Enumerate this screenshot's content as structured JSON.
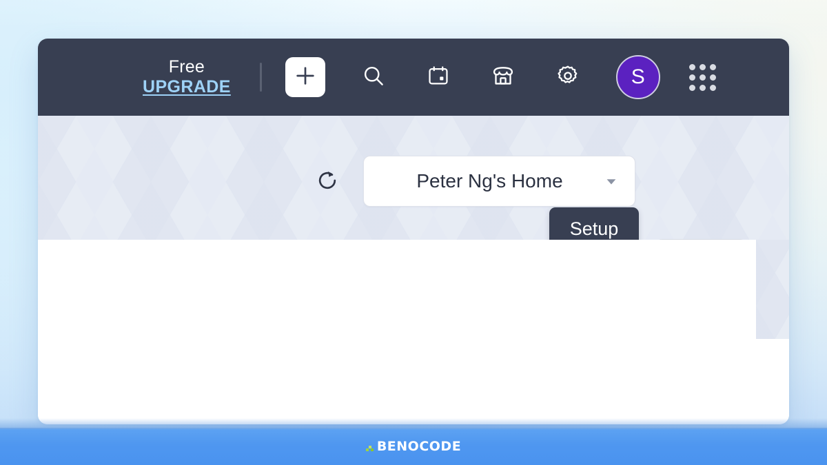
{
  "window": {
    "background_gradient_from": "#f2fbfe",
    "background_gradient_to": "#bcd9f7"
  },
  "topbar": {
    "background_color": "#383f52",
    "plan_label": "Free",
    "upgrade_label": "UPGRADE",
    "upgrade_color": "#9ed2f7",
    "divider": "|",
    "icons": [
      {
        "name": "add-icon",
        "glyph": "plus",
        "label": "Add"
      },
      {
        "name": "search-icon",
        "glyph": "magnifier",
        "label": "Search"
      },
      {
        "name": "calendar-icon",
        "glyph": "calendar",
        "label": "Calendar"
      },
      {
        "name": "store-icon",
        "glyph": "storefront",
        "label": "Store"
      },
      {
        "name": "gear-icon",
        "glyph": "gear",
        "label": "Settings"
      }
    ],
    "avatar": {
      "initial": "S",
      "background_color": "#5b21c0",
      "ring_color": "#cfcde2"
    },
    "apps_grid": {
      "name": "apps-grid-icon",
      "dot_color": "#d9dce3",
      "dots": 9
    }
  },
  "subheader": {
    "background_color": "#eff1f5",
    "refresh_icon": "refresh-icon",
    "site_select": {
      "value": "Peter Ng's Home",
      "caret": "chevron-down-icon"
    },
    "more_button": {
      "label": "•••",
      "dots": 3
    },
    "tooltip": {
      "text": "Setup",
      "background_color": "#383f52"
    }
  },
  "content": {
    "background_color": "#ffffff"
  },
  "footer": {
    "brand_text": "BENOCODE",
    "brand_mark": "benocode-logo-mark",
    "band_color": "#4f97f0",
    "accent_color": "#9ed33f"
  }
}
